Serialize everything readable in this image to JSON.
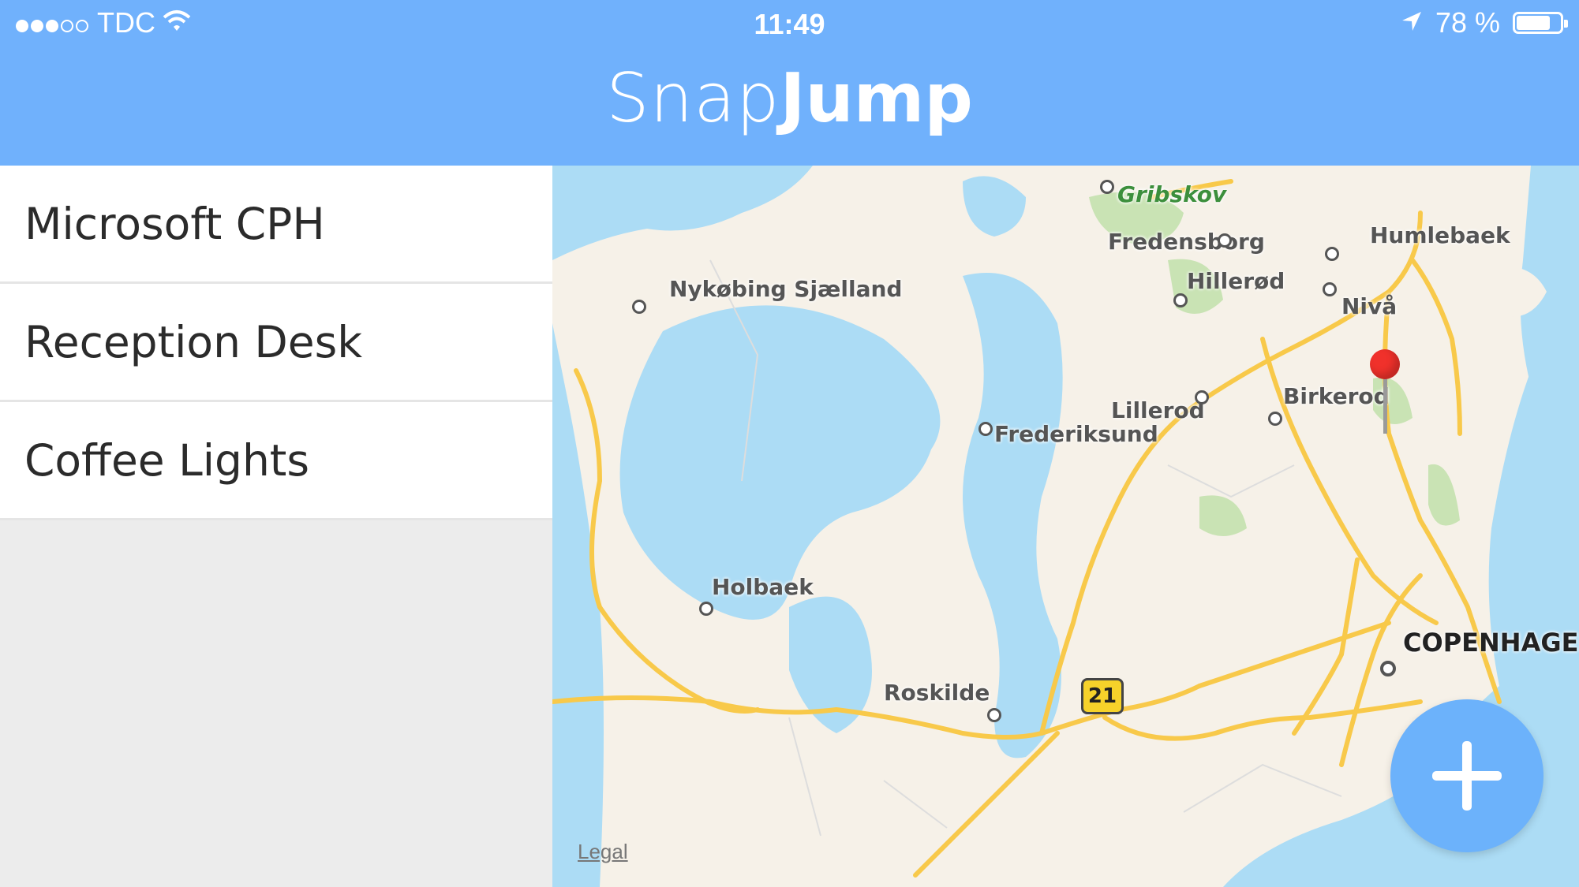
{
  "status_bar": {
    "carrier": "TDC",
    "time": "11:49",
    "battery": "78 %",
    "battery_level": 0.78,
    "icons": [
      "signal-icon",
      "wifi-icon",
      "location-arrow-icon",
      "battery-icon"
    ]
  },
  "header": {
    "title_part1": "Snap",
    "title_part2": "Jump",
    "background": "#70b1fc"
  },
  "sidebar": {
    "items": [
      {
        "label": "Microsoft CPH"
      },
      {
        "label": "Reception Desk"
      },
      {
        "label": "Coffee Lights"
      }
    ]
  },
  "map": {
    "labels": {
      "gribskov": "Gribskov",
      "fredensborg": "Fredensborg",
      "humlebaek": "Humlebaek",
      "nykobing": "Nykøbing Sjælland",
      "hillerod": "Hillerød",
      "niva": "Nivå",
      "birkerod": "Birkerod",
      "lillerod": "Lillerod",
      "frederiksund": "Frederiksund",
      "holbaek": "Holbaek",
      "roskilde": "Roskilde",
      "copenhagen": "COPENHAGEN"
    },
    "road_shield": "21",
    "legal": "Legal",
    "colors": {
      "water": "#acdcf5",
      "land": "#f6f1e8",
      "park": "#c9e3b4",
      "road": "#f8c94a",
      "pin": "#f0312b"
    }
  },
  "fab": {
    "icon": "plus-icon",
    "color": "#6cb2fb"
  }
}
